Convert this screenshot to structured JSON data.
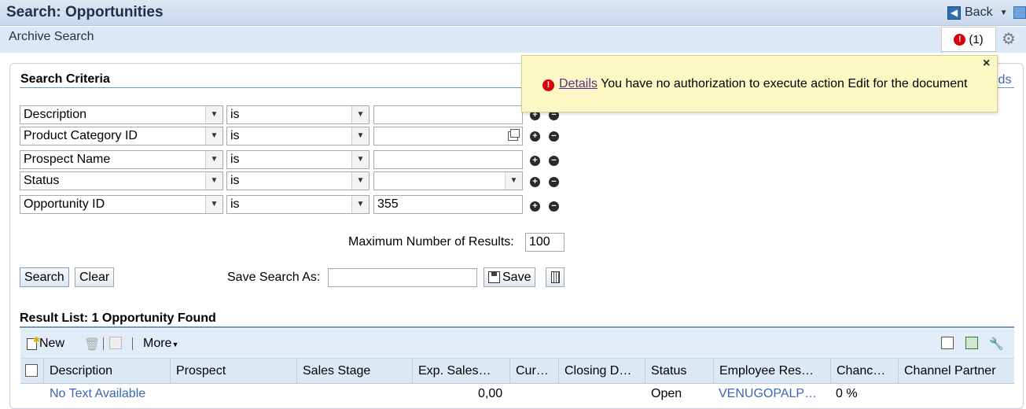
{
  "header": {
    "title": "Search: Opportunities",
    "back_label": "Back",
    "subtitle": "Archive Search",
    "message_count": "(1)"
  },
  "criteria": {
    "section_title": "Search Criteria",
    "fields_link_partial": "lds",
    "rows": [
      {
        "field": "Description",
        "operator": "is",
        "value": ""
      },
      {
        "field": "Product Category ID",
        "operator": "is",
        "value": ""
      },
      {
        "field": "Prospect Name",
        "operator": "is",
        "value": ""
      },
      {
        "field": "Status",
        "operator": "is",
        "value": ""
      },
      {
        "field": "Opportunity ID",
        "operator": "is",
        "value": "355"
      }
    ],
    "max_results_label": "Maximum Number of Results:",
    "max_results_value": "100",
    "search_button": "Search",
    "clear_button": "Clear",
    "save_search_label": "Save Search As:",
    "save_search_value": "",
    "save_button": "Save"
  },
  "results": {
    "title": "Result List: 1 Opportunity Found",
    "toolbar": {
      "new_label": "New",
      "more_label": "More"
    },
    "columns": [
      "Description",
      "Prospect",
      "Sales Stage",
      "Exp. Sales…",
      "Cur…",
      "Closing D…",
      "Status",
      "Employee Res…",
      "Chanc…",
      "Channel Partner"
    ],
    "rows": [
      {
        "description": "No Text Available",
        "prospect": "",
        "sales_stage": "",
        "exp_sales": "0,00",
        "currency": "",
        "closing_date": "",
        "status": "Open",
        "employee": "VENUGOPALP…",
        "chance": "0 %",
        "channel_partner": ""
      }
    ]
  },
  "popup": {
    "link_text": "Details",
    "message": "You have no authorization to execute action Edit for the document",
    "close_symbol": "×"
  },
  "icons": {
    "accent": "#2f6db5",
    "error": "#d8000c"
  }
}
